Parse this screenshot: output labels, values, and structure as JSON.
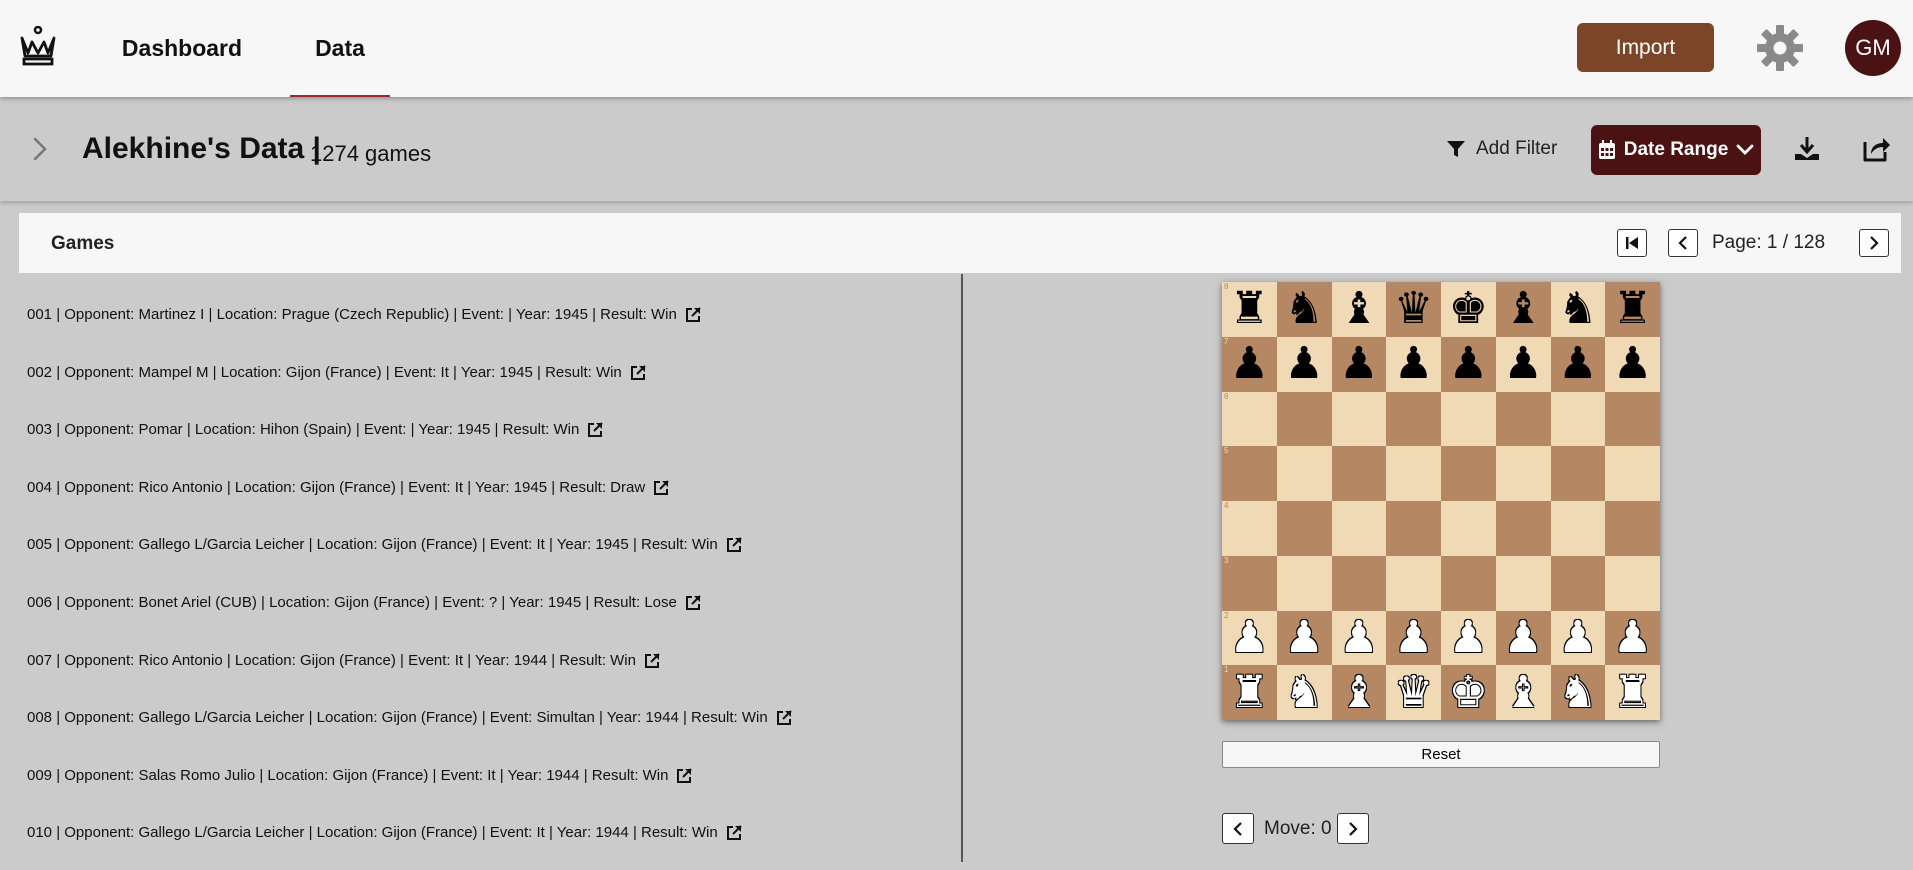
{
  "nav": {
    "logo_icon": "queen-crown-icon",
    "tabs": [
      {
        "label": "Dashboard",
        "active": false
      },
      {
        "label": "Data",
        "active": true
      }
    ],
    "import_label": "Import",
    "settings_icon": "gear-icon",
    "avatar_initials": "GM"
  },
  "titlebar": {
    "title": "Alekhine's Data |",
    "count": "1274 games",
    "add_filter_label": "Add Filter",
    "date_range_label": "Date Range",
    "download_icon": "download-icon",
    "share_icon": "share-icon"
  },
  "games": {
    "header": "Games",
    "page_text": "Page: 1 / 128",
    "rows": [
      "001 | Opponent: Martinez I | Location: Prague (Czech Republic) | Event: | Year: 1945 | Result: Win",
      "002 | Opponent: Mampel M | Location: Gijon (France) | Event: It | Year: 1945 | Result: Win",
      "003 | Opponent: Pomar | Location: Hihon (Spain) | Event: | Year: 1945 | Result: Win",
      "004 | Opponent: Rico Antonio | Location: Gijon (France) | Event: It | Year: 1945 | Result: Draw",
      "005 | Opponent: Gallego L/Garcia Leicher | Location: Gijon (France) | Event: It | Year: 1945 | Result: Win",
      "006 | Opponent: Bonet Ariel (CUB) | Location: Gijon (France) | Event: ? | Year: 1945 | Result: Lose",
      "007 | Opponent: Rico Antonio | Location: Gijon (France) | Event: It | Year: 1944 | Result: Win",
      "008 | Opponent: Gallego L/Garcia Leicher | Location: Gijon (France) | Event: Simultan | Year: 1944 | Result: Win",
      "009 | Opponent: Salas Romo Julio | Location: Gijon (France) | Event: It | Year: 1944 | Result: Win",
      "010 | Opponent: Gallego L/Garcia Leicher | Location: Gijon (France) | Event: It | Year: 1944 | Result: Win"
    ]
  },
  "board": {
    "ranks": [
      [
        "r",
        "n",
        "b",
        "q",
        "k",
        "b",
        "n",
        "r"
      ],
      [
        "p",
        "p",
        "p",
        "p",
        "p",
        "p",
        "p",
        "p"
      ],
      [
        "",
        "",
        "",
        "",
        "",
        "",
        "",
        ""
      ],
      [
        "",
        "",
        "",
        "",
        "",
        "",
        "",
        ""
      ],
      [
        "",
        "",
        "",
        "",
        "",
        "",
        "",
        ""
      ],
      [
        "",
        "",
        "",
        "",
        "",
        "",
        "",
        ""
      ],
      [
        "P",
        "P",
        "P",
        "P",
        "P",
        "P",
        "P",
        "P"
      ],
      [
        "R",
        "N",
        "B",
        "Q",
        "K",
        "B",
        "N",
        "R"
      ]
    ],
    "rank_labels": [
      "8",
      "7",
      "6",
      "5",
      "4",
      "3",
      "2",
      "1"
    ],
    "reset_label": "Reset",
    "move_text": "Move: 0"
  },
  "colors": {
    "import": "#7d4528",
    "date_range": "#4a1212",
    "avatar": "#4a1212",
    "board_light": "#f0d9b5",
    "board_dark": "#b58863"
  }
}
